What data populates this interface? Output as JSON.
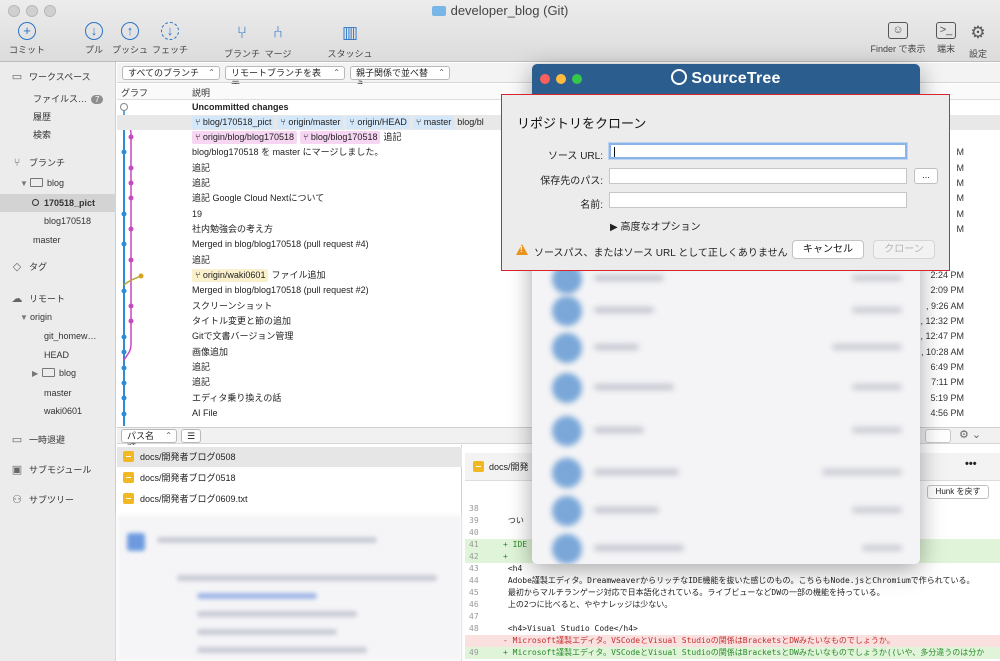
{
  "window": {
    "title": "developer_blog (Git)"
  },
  "toolbar": {
    "commit": "コミット",
    "pull": "プル",
    "push": "プッシュ",
    "fetch": "フェッチ",
    "branch": "ブランチ",
    "merge": "マージ",
    "stash": "スタッシュ",
    "finder": "Finder で表示",
    "terminal": "端末",
    "settings": "設定"
  },
  "sidebar": {
    "workspace": "ワークスペース",
    "file_status": "ファイルス…",
    "file_status_count": "7",
    "history": "履歴",
    "search": "検索",
    "branches": "ブランチ",
    "branch_folder": "blog",
    "current_branch": "170518_pict",
    "branch_blog170518": "blog170518",
    "branch_master": "master",
    "tags": "タグ",
    "remotes": "リモート",
    "remote_origin": "origin",
    "remote_git_homework": "git_homew…",
    "remote_head": "HEAD",
    "remote_blog": "blog",
    "remote_master": "master",
    "remote_waki": "waki0601",
    "stashes": "一時退避",
    "submodules": "サブモジュール",
    "subtrees": "サブツリー"
  },
  "filters": {
    "all_branches": "すべてのブランチ",
    "show_remote": "リモートブランチを表示",
    "sort": "親子関係で並べ替え"
  },
  "columns": {
    "graph": "グラフ",
    "description": "説明"
  },
  "commits": {
    "uncommitted": "Uncommitted changes",
    "r1_tags": [
      "blog/170518_pict",
      "origin/master",
      "origin/HEAD",
      "master"
    ],
    "r1_msg": "blog/bl",
    "r2_tags": [
      "origin/blog/blog170518",
      "blog/blog170518"
    ],
    "r2_msg": "追記",
    "r3": "blog/blog170518 を master にマージしました。",
    "r4": "追記",
    "r5": "追記",
    "r6": "追記 Google Cloud Nextについて",
    "r7": "19",
    "r8": "社内勉強会の考え方",
    "r9": "Merged in blog/blog170518 (pull request #4)",
    "r10": "追記",
    "r11_tag": "origin/waki0601",
    "r11_msg": "ファイル追加",
    "r12": "Merged in blog/blog170518 (pull request #2)",
    "r13": "スクリーンショット",
    "r14": "タイトル変更と節の追加",
    "r15": "Gitで文書バージョン管理",
    "r16": "画像追加",
    "r17": "追記",
    "r18": "追記",
    "r19": "エディタ乗り換えの話",
    "r20": "AI File"
  },
  "times": {
    "t1": "M",
    "t2": "M",
    "t3": "M",
    "t4": "M",
    "t5": "M",
    "t6": "M",
    "t7": "2:24 PM",
    "t8": "2:09 PM",
    "t9": ", 9:26 AM",
    "t10": ", 12:32 PM",
    "t11": ", 12:47 PM",
    "t12": ", 10:28 AM",
    "t13": "6:49 PM",
    "t14": "7:11 PM",
    "t15": "5:19 PM",
    "t16": "4:56 PM"
  },
  "lower": {
    "sort_label": "パス名順",
    "files": [
      "docs/開発者ブログ0508",
      "docs/開発者ブログ0518",
      "docs/開発者ブログ0609.txt"
    ],
    "diff_file": "docs/開発",
    "hunk_button": "Hunk を戻す",
    "more": "•••"
  },
  "diff_lines": [
    {
      "ln": "38",
      "text": ""
    },
    {
      "ln": "39",
      "text": "  つい"
    },
    {
      "ln": "40",
      "text": ""
    },
    {
      "ln": "41",
      "text": "+ IDE"
    },
    {
      "ln": "42",
      "text": "+"
    },
    {
      "ln": "43",
      "text": "  <h4"
    },
    {
      "ln": "44",
      "text": "  Adobe謹製エディタ。DreamweaverからリッチなIDE機能を抜いた感じのもの。こちらもNode.jsとChromiumで作られている。"
    },
    {
      "ln": "45",
      "text": "  最初からマルチランゲージ対応で日本語化されている。ライブビューなどDWの一部の機能を持っている。"
    },
    {
      "ln": "46",
      "text": "  上の2つに比べると、ややナレッジは少ない。"
    },
    {
      "ln": "47",
      "text": ""
    },
    {
      "ln": "48",
      "text": "  <h4>Visual Studio Code</h4>"
    },
    {
      "ln": "",
      "text": "- Microsoft謹製エディタ。VSCodeとVisual Studioの関係はBracketsとDWみたいなものでしょうか。"
    },
    {
      "ln": "49",
      "text": "+ Microsoft謹製エディタ。VSCodeとVisual Studioの関係はBracketsとDWみたいなものでしょうか((いや、多分違うのは分か"
    }
  ],
  "sourcetree": {
    "logo": "SourceTree"
  },
  "dialog": {
    "title": "リポジトリをクローン",
    "source_label": "ソース URL:",
    "dest_label": "保存先のパス:",
    "name_label": "名前:",
    "browse": "...",
    "advanced": "▶ 高度なオプション",
    "warning": "ソースパス、またはソース URL として正しくありません",
    "cancel": "キャンセル",
    "clone": "クローン"
  },
  "colors": {
    "dialog_border": "#d8242a",
    "sourcetree_blue": "#2b5d8e",
    "graph_blue": "#2e8bd6",
    "graph_magenta": "#c649c0"
  }
}
